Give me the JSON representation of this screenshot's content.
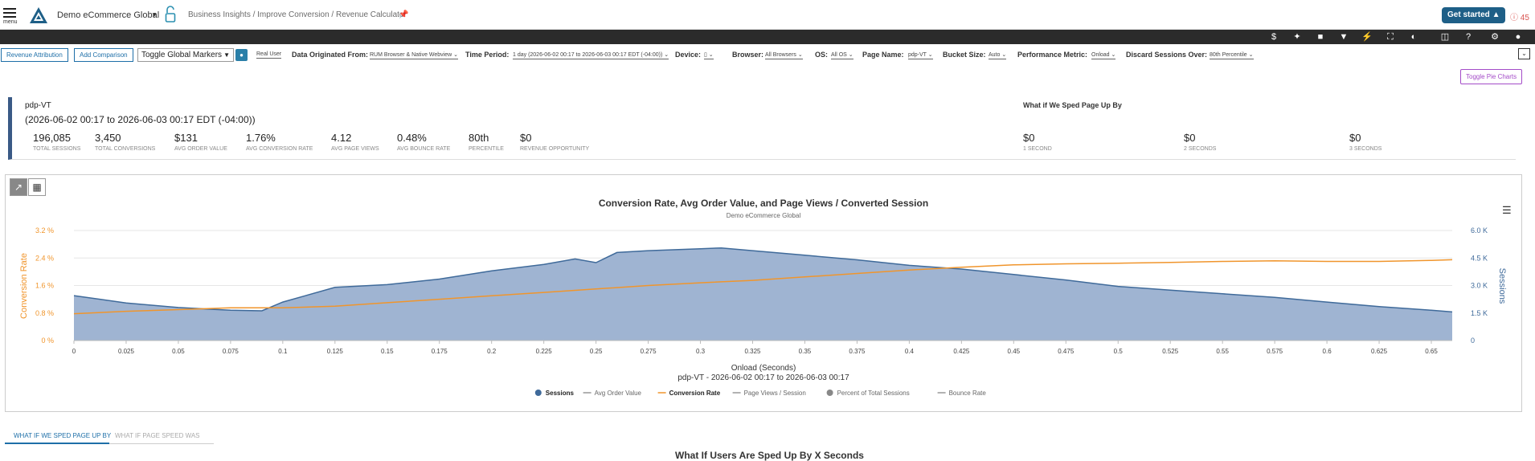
{
  "header": {
    "menu_label": "menu",
    "account": "Demo eCommerce Global",
    "breadcrumb": "Business Insights / Improve Conversion / Revenue Calculator",
    "get_started": "Get started",
    "alert_count": "45"
  },
  "filters": {
    "revenue_attribution": "Revenue Attribution",
    "add_comparison": "Add Comparison",
    "toggle_markers": "Toggle Global Markers",
    "real_user": "Real User",
    "data_origin_label": "Data Originated From:",
    "data_origin_value": "RUM Browser & Native Webview",
    "time_period_label": "Time Period:",
    "time_period_value": "1 day (2026-06-02 00:17 to 2026-06-03 00:17 EDT (-04:00))",
    "device_label": "Device:",
    "browser_label": "Browser:",
    "browser_value": "All Browsers",
    "os_label": "OS:",
    "os_value": "All OS",
    "page_name_label": "Page Name:",
    "page_name_value": "pdp-VT",
    "bucket_label": "Bucket Size:",
    "bucket_value": "Auto",
    "metric_label": "Performance Metric:",
    "metric_value": "Onload",
    "discard_label": "Discard Sessions Over:",
    "discard_value": "80th Percentile"
  },
  "toggle_pie": "Toggle Pie Charts",
  "summary": {
    "page_name": "pdp-VT",
    "range": "(2026-06-02 00:17 to 2026-06-03 00:17 EDT (-04:00))",
    "stats": [
      {
        "value": "196,085",
        "label": "Total Sessions"
      },
      {
        "value": "3,450",
        "label": "Total Conversions"
      },
      {
        "value": "$131",
        "label": "Avg Order Value"
      },
      {
        "value": "1.76%",
        "label": "Avg Conversion Rate"
      },
      {
        "value": "4.12",
        "label": "Avg Page Views"
      },
      {
        "value": "0.48%",
        "label": "Avg Bounce Rate"
      },
      {
        "value": "80th",
        "label": "Percentile"
      },
      {
        "value": "$0",
        "label": "Revenue Opportunity"
      }
    ],
    "whatif_title": "What if We Sped Page Up By",
    "whatif": [
      {
        "value": "$0",
        "label": "1 Second"
      },
      {
        "value": "$0",
        "label": "2 Seconds"
      },
      {
        "value": "$0",
        "label": "3 Seconds"
      }
    ]
  },
  "chart_data": {
    "type": "area",
    "title": "Conversion Rate, Avg Order Value, and Page Views / Converted Session",
    "subtitle": "Demo eCommerce Global",
    "xlabel": "Onload (Seconds)",
    "xlabel2": "pdp-VT - 2026-06-02 00:17 to 2026-06-03 00:17",
    "ylabel_left": "Conversion Rate",
    "ylabel_right": "Sessions",
    "xlim": [
      0,
      0.66
    ],
    "x_ticks": [
      "0",
      "0.025",
      "0.05",
      "0.075",
      "0.1",
      "0.125",
      "0.15",
      "0.175",
      "0.2",
      "0.225",
      "0.25",
      "0.275",
      "0.3",
      "0.325",
      "0.35",
      "0.375",
      "0.4",
      "0.425",
      "0.45",
      "0.475",
      "0.5",
      "0.525",
      "0.55",
      "0.575",
      "0.6",
      "0.625",
      "0.65"
    ],
    "y_left_ticks": [
      "0 %",
      "0.8 %",
      "1.6 %",
      "2.4 %",
      "3.2 %"
    ],
    "y_left_range": [
      0,
      3.2
    ],
    "y_right_ticks": [
      "0",
      "1.5 K",
      "3.0 K",
      "4.5 K",
      "6.0 K"
    ],
    "y_right_range": [
      0,
      6000
    ],
    "sessions": {
      "name": "Sessions",
      "color": "#3f6a9a",
      "x": [
        0,
        0.025,
        0.05,
        0.075,
        0.09,
        0.1,
        0.125,
        0.15,
        0.175,
        0.2,
        0.225,
        0.24,
        0.25,
        0.26,
        0.275,
        0.3,
        0.31,
        0.325,
        0.35,
        0.375,
        0.4,
        0.425,
        0.45,
        0.475,
        0.5,
        0.525,
        0.55,
        0.575,
        0.6,
        0.625,
        0.65,
        0.66
      ],
      "values": [
        2450,
        2050,
        1800,
        1650,
        1620,
        2100,
        2900,
        3050,
        3350,
        3800,
        4150,
        4450,
        4250,
        4800,
        4900,
        5000,
        5050,
        4900,
        4650,
        4400,
        4100,
        3900,
        3600,
        3300,
        2950,
        2750,
        2550,
        2350,
        2100,
        1850,
        1650,
        1560
      ]
    },
    "conversion_rate": {
      "name": "Conversion Rate",
      "color": "#f0952c",
      "x": [
        0,
        0.025,
        0.05,
        0.075,
        0.1,
        0.125,
        0.15,
        0.175,
        0.2,
        0.225,
        0.25,
        0.275,
        0.3,
        0.325,
        0.35,
        0.375,
        0.4,
        0.425,
        0.45,
        0.475,
        0.5,
        0.525,
        0.55,
        0.575,
        0.6,
        0.625,
        0.65,
        0.66
      ],
      "values": [
        0.78,
        0.85,
        0.9,
        0.95,
        0.95,
        1.0,
        1.1,
        1.2,
        1.3,
        1.4,
        1.5,
        1.6,
        1.68,
        1.75,
        1.85,
        1.95,
        2.05,
        2.13,
        2.2,
        2.23,
        2.25,
        2.27,
        2.3,
        2.32,
        2.3,
        2.3,
        2.33,
        2.35
      ]
    },
    "legend": [
      {
        "name": "Sessions",
        "kind": "dot",
        "color": "#3f6a9a",
        "active": true
      },
      {
        "name": "Avg Order Value",
        "kind": "line",
        "color": "#999999",
        "active": false
      },
      {
        "name": "Conversion Rate",
        "kind": "line",
        "color": "#f0952c",
        "active": true
      },
      {
        "name": "Page Views / Session",
        "kind": "line",
        "color": "#999999",
        "active": false
      },
      {
        "name": "Percent of Total Sessions",
        "kind": "dot",
        "color": "#888888",
        "active": false
      },
      {
        "name": "Bounce Rate",
        "kind": "line",
        "color": "#999999",
        "active": false
      }
    ]
  },
  "tabs": [
    {
      "label": "What If We Sped Page Up By"
    },
    {
      "label": "What If Page Speed Was"
    }
  ],
  "bottom_title": "What If Users Are Sped Up By X Seconds"
}
